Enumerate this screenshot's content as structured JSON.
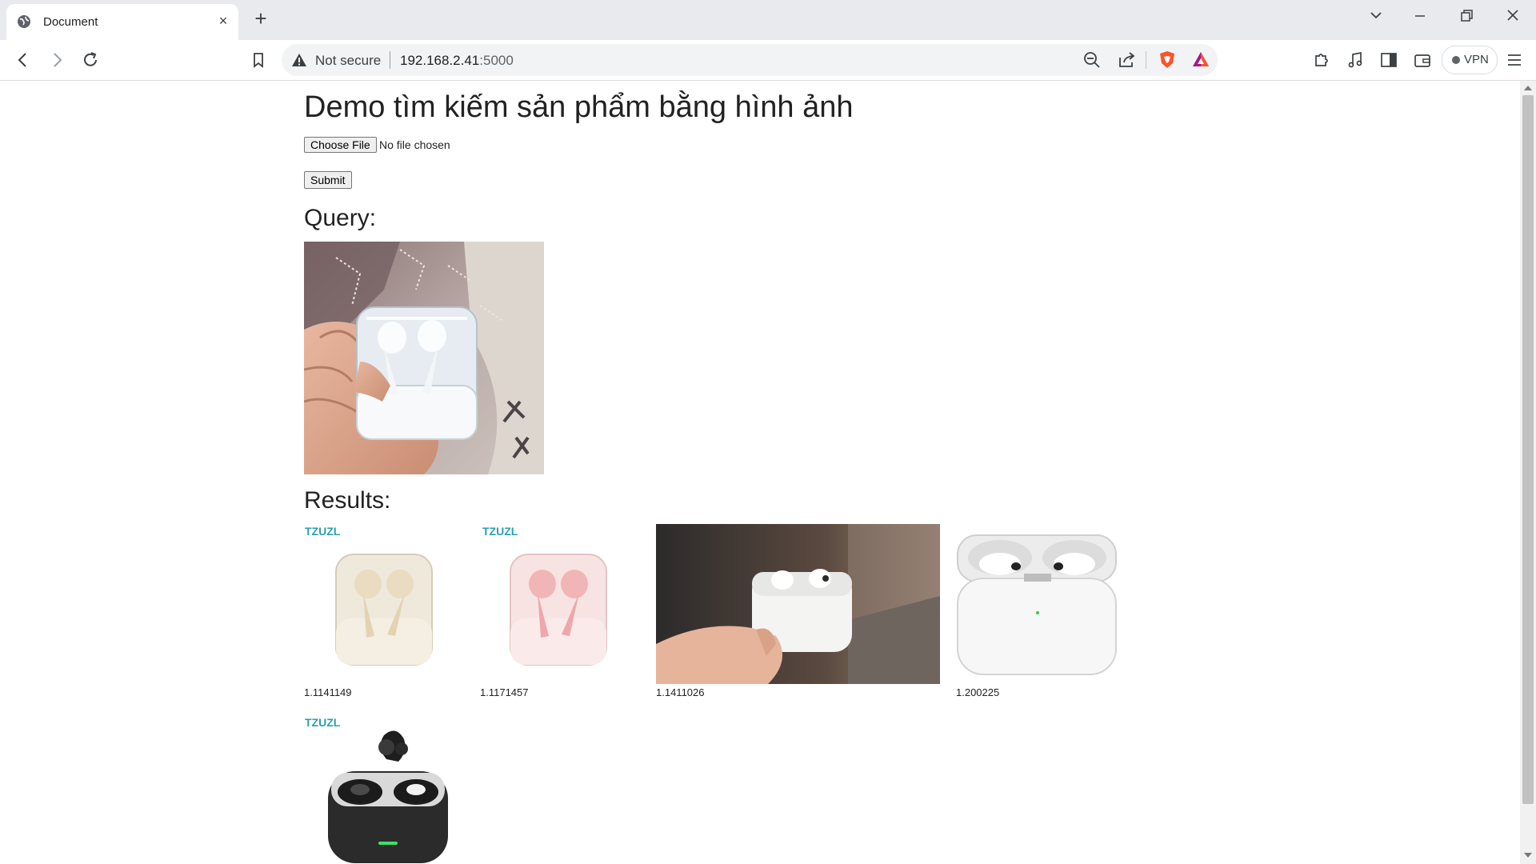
{
  "browser": {
    "tab_title": "Document",
    "tab_close": "×",
    "new_tab": "+",
    "security_label": "Not secure",
    "url_host": "192.168.2.41",
    "url_port": ":5000",
    "vpn_label": "VPN",
    "icons": [
      "globe-icon",
      "back-icon",
      "forward-icon",
      "reload-icon",
      "bookmark-icon",
      "warning-icon",
      "zoom-out-icon",
      "share-icon",
      "brave-shield-icon",
      "brave-rewards-icon",
      "extensions-icon",
      "media-icon",
      "sidebar-icon",
      "wallet-icon",
      "menu-icon",
      "minimize-icon",
      "restore-icon",
      "close-icon",
      "tab-search-icon"
    ],
    "colors": {
      "tabbar": "#e8eaed",
      "omnibox": "#f1f3f4",
      "brave_shield": "#fb542b"
    }
  },
  "page": {
    "title": "Demo tìm kiếm sản phẩm bằng hình ảnh",
    "choose_file_label": "Choose File",
    "no_file_text": "No file chosen",
    "submit_label": "Submit",
    "query_label": "Query:",
    "results_label": "Results:",
    "results": [
      {
        "brand": "TZUZL",
        "score": "1.1141149",
        "image": "cream earbuds in clear case"
      },
      {
        "brand": "TZUZL",
        "score": "1.1171457",
        "image": "pink earbuds in clear case"
      },
      {
        "brand": "",
        "score": "1.1411026",
        "image": "hand holding white earbuds case"
      },
      {
        "brand": "",
        "score": "1.200225",
        "image": "white AirPods Pro case"
      },
      {
        "brand": "TZUZL",
        "score": "",
        "image": "black open-ear earbuds with charging case"
      }
    ]
  }
}
